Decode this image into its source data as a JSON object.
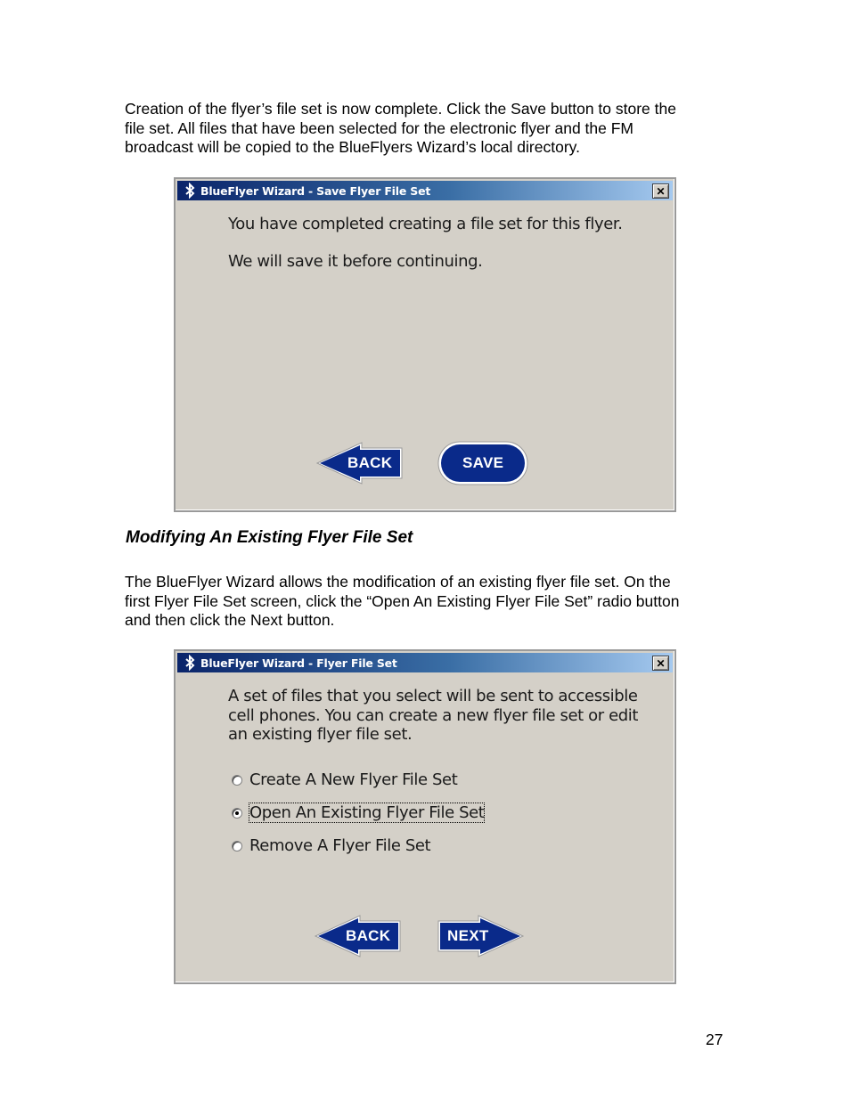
{
  "intro_paragraph": [
    "Creation of the flyer’s file set is now complete.  Click the Save button to store the",
    "file set.  All files that have been selected for the electronic flyer and the FM",
    "broadcast will be copied to the BlueFlyers Wizard’s local directory."
  ],
  "dialog_save": {
    "title": "BlueFlyer Wizard - Save Flyer File Set",
    "close_label": "✕",
    "line1": "You have completed creating a file set for this flyer.",
    "line2": "We will save it before continuing.",
    "back_label": "BACK",
    "save_label": "SAVE"
  },
  "section_heading": "Modifying An Existing Flyer File Set",
  "modify_paragraph": [
    "The BlueFlyer Wizard allows the modification of an existing flyer file set.  On the",
    "first Flyer File Set screen, click the “Open An Existing Flyer File Set” radio button",
    "and then click the Next button."
  ],
  "dialog_fileset": {
    "title": "BlueFlyer Wizard - Flyer File Set",
    "close_label": "✕",
    "description": [
      "A set of files that you select will be sent to accessible",
      "cell phones.  You can create a new flyer file set or edit",
      "an existing flyer file set."
    ],
    "options": [
      {
        "label": "Create A New Flyer File Set",
        "selected": false
      },
      {
        "label": "Open An Existing Flyer File Set",
        "selected": true
      },
      {
        "label": "Remove A Flyer File Set",
        "selected": false
      }
    ],
    "back_label": "BACK",
    "next_label": "NEXT"
  },
  "page_number": "27",
  "colors": {
    "button_blue": "#0a2a8a",
    "dialog_gray": "#d4d0c8"
  },
  "icons": [
    "bluetooth-icon",
    "close-icon",
    "back-arrow-icon",
    "next-arrow-icon"
  ]
}
